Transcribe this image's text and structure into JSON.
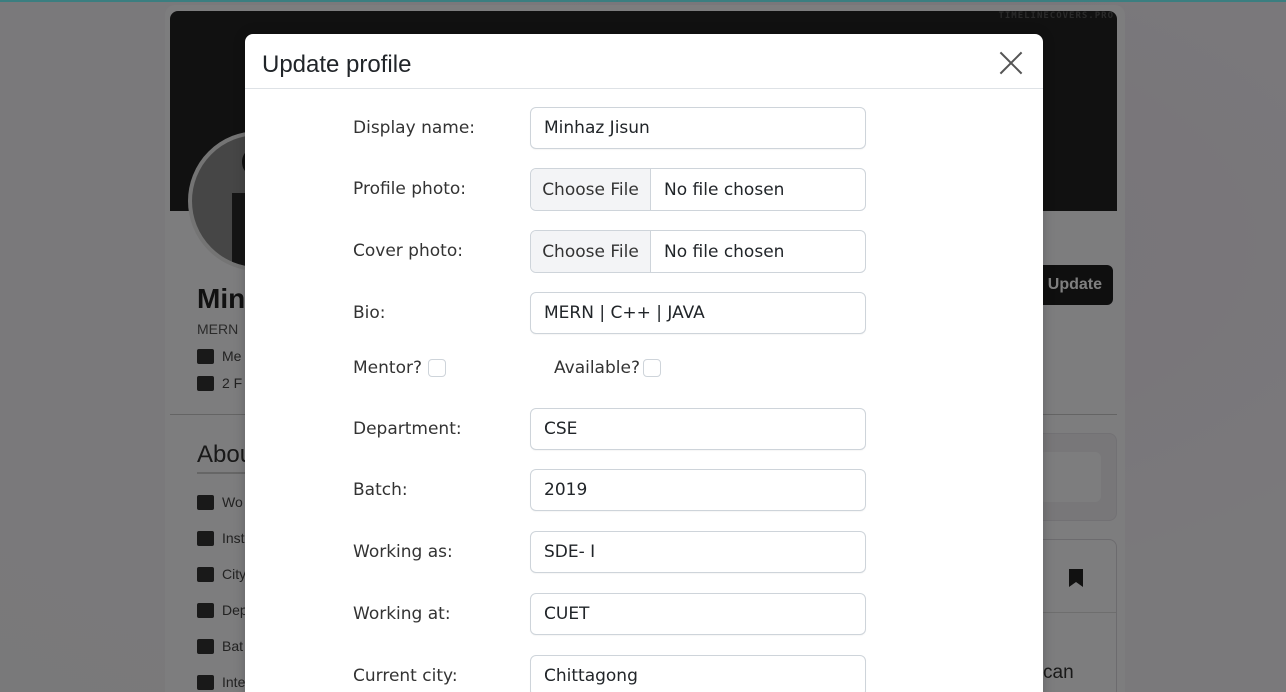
{
  "background": {
    "watermark": "TIMELINECOVERS.PRO",
    "profile_name_partial": "Min",
    "profile_sub_partial": "MERN",
    "info_rows": [
      "Me",
      "2 F"
    ],
    "about_partial": "Abou",
    "about_rows": [
      "Wo",
      "Inst",
      "City",
      "Dep",
      "Bat",
      "Inte"
    ],
    "update_button": "Update",
    "right_text_partial": "can"
  },
  "modal": {
    "title": "Update profile",
    "close_icon": "close-icon"
  },
  "form": {
    "display_name": {
      "label": "Display name:",
      "value": "Minhaz Jisun"
    },
    "profile_photo": {
      "label": "Profile photo:",
      "button": "Choose File",
      "status": "No file chosen"
    },
    "cover_photo": {
      "label": "Cover photo:",
      "button": "Choose File",
      "status": "No file chosen"
    },
    "bio": {
      "label": "Bio:",
      "value": "MERN | C++ | JAVA"
    },
    "mentor": {
      "label": "Mentor?"
    },
    "available": {
      "label": "Available?"
    },
    "department": {
      "label": "Department:",
      "value": "CSE"
    },
    "batch": {
      "label": "Batch:",
      "value": "2019"
    },
    "working_as": {
      "label": "Working as:",
      "value": "SDE- I"
    },
    "working_at": {
      "label": "Working at:",
      "value": "CUET"
    },
    "current_city": {
      "label": "Current city:",
      "value": "Chittagong"
    }
  }
}
